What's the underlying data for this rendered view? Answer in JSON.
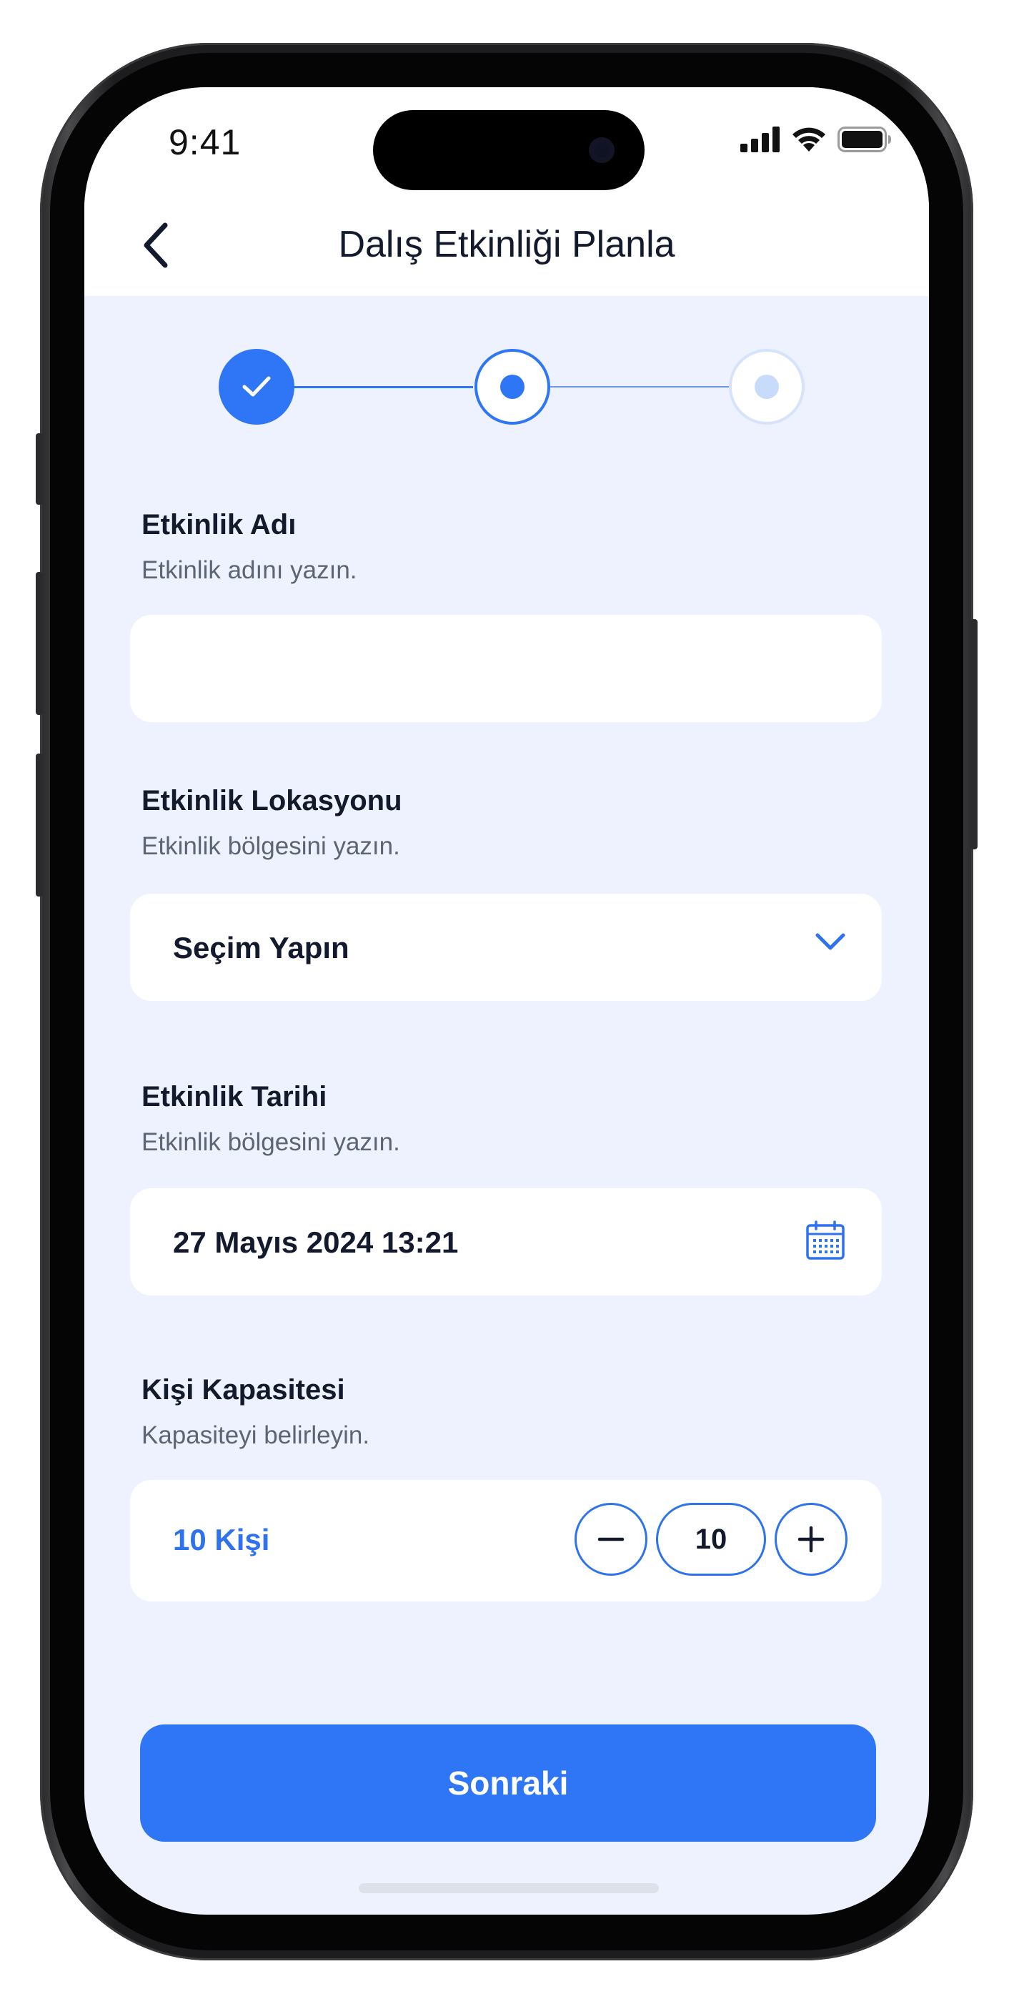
{
  "status_bar": {
    "time": "9:41"
  },
  "header": {
    "title": "Dalış Etkinliği Planla",
    "back_icon": "chevron-left-icon"
  },
  "stepper": {
    "steps": [
      {
        "state": "completed",
        "icon": "check-icon"
      },
      {
        "state": "current"
      },
      {
        "state": "upcoming"
      }
    ],
    "colors": {
      "active": "#2f76f6",
      "inactive": "#cfddfb"
    }
  },
  "form": {
    "event_name": {
      "title": "Etkinlik Adı",
      "subtitle": "Etkinlik adını yazın.",
      "value": ""
    },
    "event_location": {
      "title": "Etkinlik Lokasyonu",
      "subtitle": "Etkinlik bölgesini yazın.",
      "selected": "Seçim Yapın",
      "icon": "chevron-down-icon"
    },
    "event_date": {
      "title": "Etkinlik Tarihi",
      "subtitle": "Etkinlik bölgesini yazın.",
      "value": "27 Mayıs 2024 13:21",
      "icon": "calendar-icon"
    },
    "capacity": {
      "title": "Kişi Kapasitesi",
      "subtitle": "Kapasiteyi belirleyin.",
      "label": "10 Kişi",
      "quantity": "10",
      "decrement_icon": "minus-icon",
      "increment_icon": "plus-icon"
    }
  },
  "actions": {
    "next_label": "Sonraki"
  },
  "colors": {
    "accent": "#2f76f6",
    "background": "#edf2fe",
    "card": "#ffffff",
    "text": "#141a2e"
  }
}
